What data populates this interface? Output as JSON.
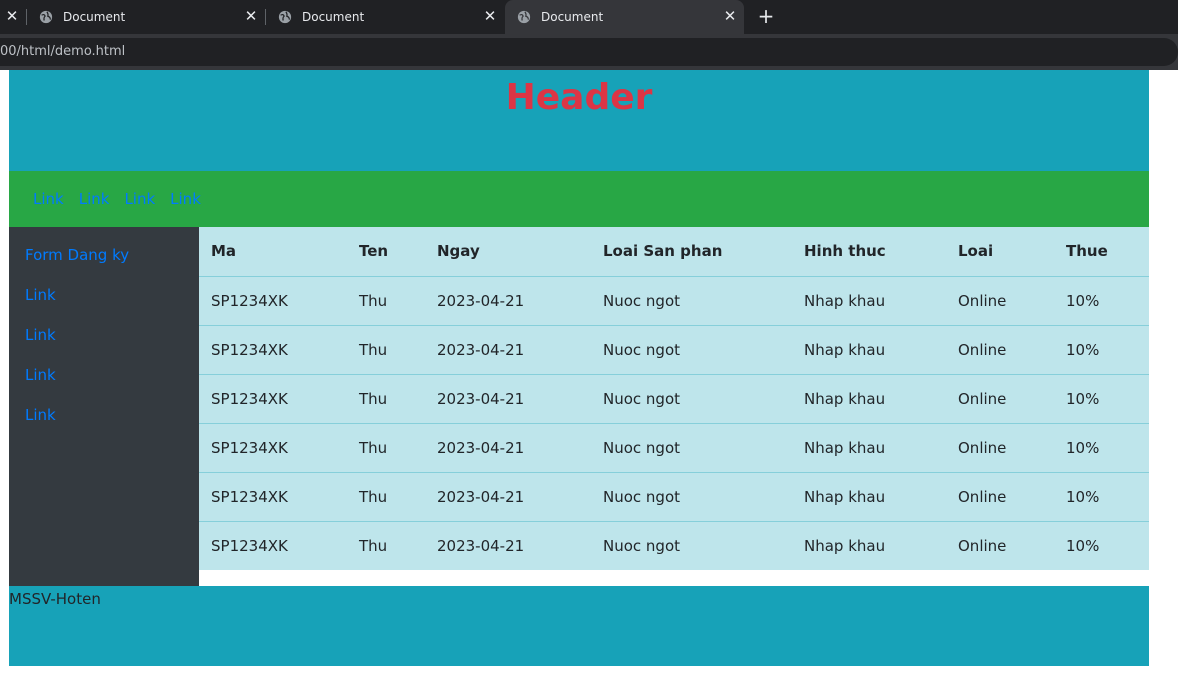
{
  "browser": {
    "tabs": [
      {
        "title": "Document"
      },
      {
        "title": "Document"
      },
      {
        "title": "Document"
      }
    ],
    "close_glyph": "✕",
    "new_tab_glyph": "+",
    "address": "00/html/demo.html"
  },
  "header": {
    "title": "Header"
  },
  "nav": {
    "links": [
      "Link",
      "Link",
      "Link",
      "Link"
    ]
  },
  "sidebar": {
    "links": [
      "Form Dang ky",
      "Link",
      "Link",
      "Link",
      "Link"
    ]
  },
  "table": {
    "headers": [
      "Ma",
      "Ten",
      "Ngay",
      "Loai San phan",
      "Hinh thuc",
      "Loai",
      "Thue"
    ],
    "rows": [
      [
        "SP1234XK",
        "Thu",
        "2023-04-21",
        "Nuoc ngot",
        "Nhap khau",
        "Online",
        "10%"
      ],
      [
        "SP1234XK",
        "Thu",
        "2023-04-21",
        "Nuoc ngot",
        "Nhap khau",
        "Online",
        "10%"
      ],
      [
        "SP1234XK",
        "Thu",
        "2023-04-21",
        "Nuoc ngot",
        "Nhap khau",
        "Online",
        "10%"
      ],
      [
        "SP1234XK",
        "Thu",
        "2023-04-21",
        "Nuoc ngot",
        "Nhap khau",
        "Online",
        "10%"
      ],
      [
        "SP1234XK",
        "Thu",
        "2023-04-21",
        "Nuoc ngot",
        "Nhap khau",
        "Online",
        "10%"
      ],
      [
        "SP1234XK",
        "Thu",
        "2023-04-21",
        "Nuoc ngot",
        "Nhap khau",
        "Online",
        "10%"
      ]
    ]
  },
  "footer": {
    "text": "MSSV-Hoten"
  },
  "colors": {
    "header_bg": "#17a2b8",
    "header_text": "#dc3545",
    "nav_bg": "#28a745",
    "link": "#007bff",
    "sidebar_bg": "#343a40",
    "table_bg": "#bee5eb"
  }
}
